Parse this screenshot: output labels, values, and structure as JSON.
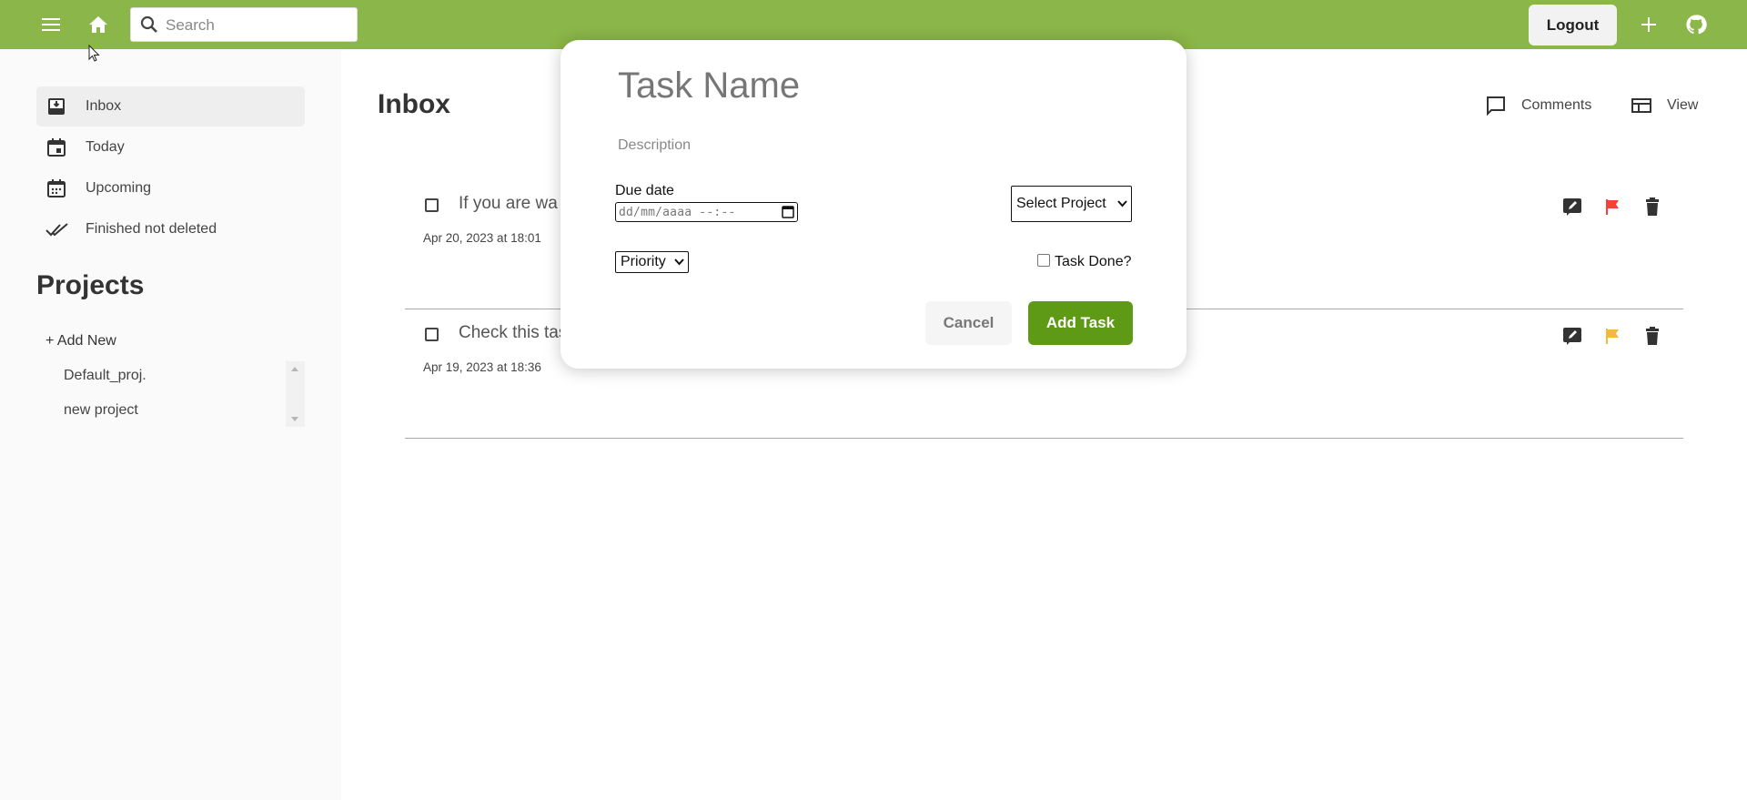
{
  "theme": {
    "accent": "#8bb649",
    "primary_button": "#5e9a16",
    "flag_high": "#f44336",
    "flag_medium": "#f6b93b"
  },
  "topbar": {
    "menu_icon": "menu-icon",
    "home_icon": "home-icon",
    "search": {
      "placeholder": "Search",
      "value": ""
    },
    "logout_label": "Logout",
    "add_icon": "plus-icon",
    "github_icon": "github-icon"
  },
  "sidebar": {
    "items": [
      {
        "label": "Inbox",
        "icon": "inbox-icon",
        "active": true
      },
      {
        "label": "Today",
        "icon": "calendar-today-icon",
        "active": false
      },
      {
        "label": "Upcoming",
        "icon": "calendar-upcoming-icon",
        "active": false
      },
      {
        "label": "Finished not deleted",
        "icon": "double-check-icon",
        "active": false
      }
    ],
    "projects_title": "Projects",
    "add_new_label": "+ Add New",
    "projects": [
      "Default_proj.",
      "new project"
    ]
  },
  "main": {
    "title": "Inbox",
    "comments_label": "Comments",
    "view_label": "View",
    "tasks": [
      {
        "name": "If you are wa",
        "date": "Apr 20, 2023 at 18:01",
        "flag": "high"
      },
      {
        "name": "Check this task",
        "date": "Apr 19, 2023 at 18:36",
        "flag": "medium"
      }
    ]
  },
  "modal": {
    "task_name_placeholder": "Task Name",
    "description_placeholder": "Description",
    "due_date_label": "Due date",
    "due_date_placeholder": "dd/mm/aaaa --:--",
    "project_select": "Select Project",
    "priority_select": "Priority",
    "task_done_label": "Task Done?",
    "task_done": false,
    "cancel_label": "Cancel",
    "add_label": "Add Task"
  }
}
